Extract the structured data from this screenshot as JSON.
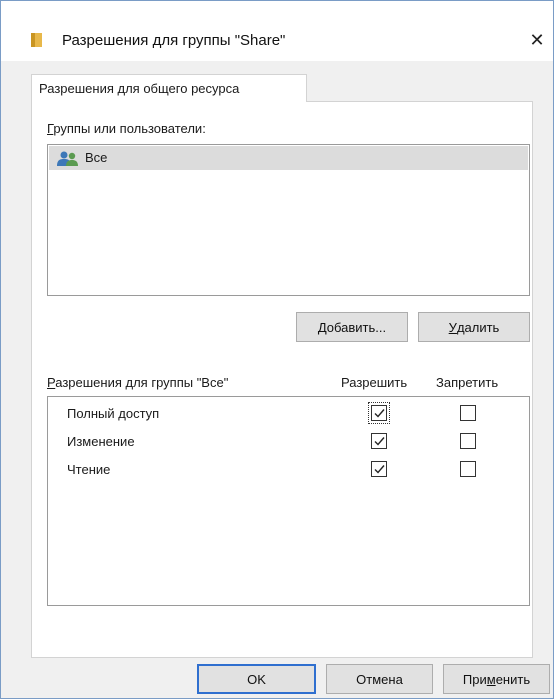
{
  "window": {
    "title": "Разрешения для группы \"Share\"",
    "close_glyph": "✕"
  },
  "tab": {
    "label": "Разрешения для общего ресурса"
  },
  "groups": {
    "label_first": "Г",
    "label_rest": "руппы или пользователи:",
    "items": [
      {
        "name": "Все",
        "selected": true,
        "icon": "users-group-icon"
      }
    ],
    "add_first": "Д",
    "add_rest": "обавить...",
    "remove_first": "У",
    "remove_rest": "далить"
  },
  "permissions": {
    "header_first": "Р",
    "header_rest": "азрешения для группы \"Все\"",
    "allow_header": "Разрешить",
    "deny_header": "Запретить",
    "rows": [
      {
        "name": "Полный доступ",
        "allow": true,
        "deny": false
      },
      {
        "name": "Изменение",
        "allow": true,
        "deny": false
      },
      {
        "name": "Чтение",
        "allow": true,
        "deny": false
      }
    ]
  },
  "footer": {
    "ok_label": "OK",
    "cancel_label": "Отмена",
    "apply_before": "При",
    "apply_underlined": "м",
    "apply_after": "енить"
  },
  "colors": {
    "accent": "#2f6fcf",
    "selection": "#dcdcdc",
    "folder": "#e8b84a"
  }
}
